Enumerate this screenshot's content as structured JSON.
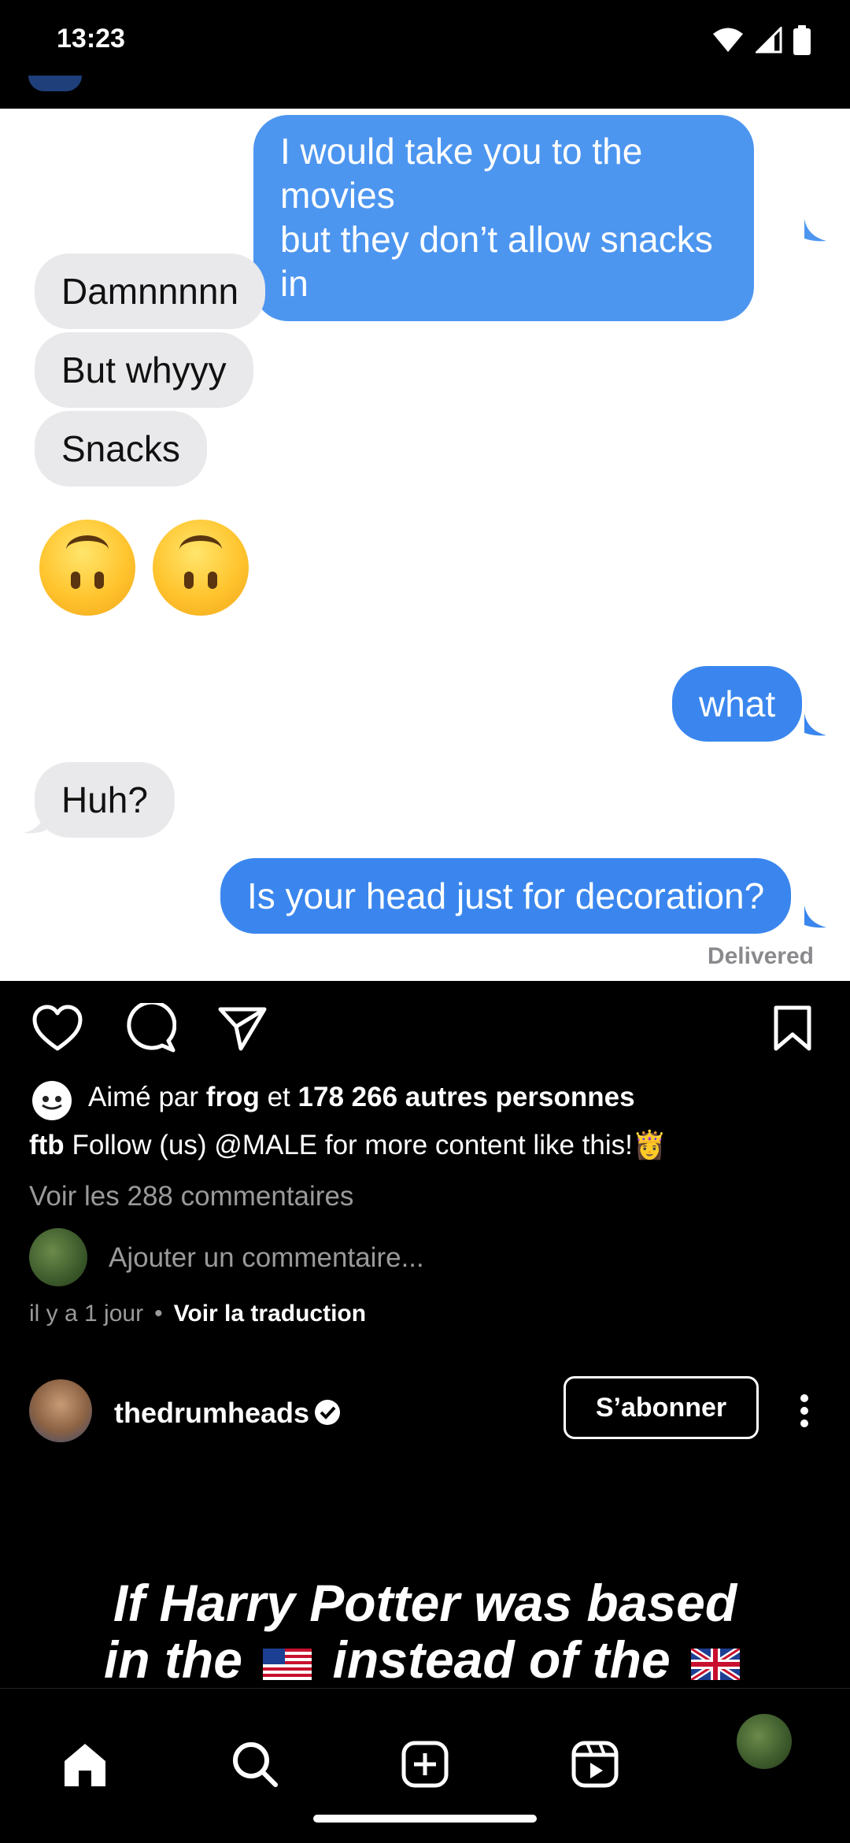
{
  "status_bar": {
    "time": "13:23"
  },
  "chat": {
    "messages": [
      {
        "side": "out",
        "lines": [
          "I would take you to the movies",
          "but they don’t allow snacks in"
        ]
      },
      {
        "side": "in",
        "text": "Damnnnnn"
      },
      {
        "side": "in",
        "text": "But whyyy"
      },
      {
        "side": "in",
        "text": "Snacks"
      },
      {
        "side": "in",
        "emoji": "upside-down-face-icon"
      },
      {
        "side": "out",
        "text": "what"
      },
      {
        "side": "in",
        "text": "Huh?"
      },
      {
        "side": "out",
        "text": "Is your head just for decoration?"
      }
    ],
    "delivered": "Delivered"
  },
  "post_actions": {
    "icons": [
      "heart-icon",
      "comment-icon",
      "share-icon",
      "bookmark-icon"
    ]
  },
  "likes": {
    "prefix": "Aimé par",
    "user": "frog",
    "joiner": "et",
    "count": "178 266 autres personnes"
  },
  "caption": {
    "username": "ftb",
    "text": "Follow (us) @MALE for more content like this!👸"
  },
  "view_comments": "Voir les 288 commentaires",
  "comment_placeholder": "Ajouter un commentaire...",
  "meta": {
    "time": "il y a 1 jour",
    "separator": "•",
    "translate": "Voir la traduction"
  },
  "next_post": {
    "username": "thedrumheads",
    "follow_label": "S’abonner",
    "text_line1": "If Harry Potter was based",
    "text_line2_a": "in the",
    "text_line2_b": "instead of the"
  },
  "bottom_nav": {
    "items": [
      "home-icon",
      "search-icon",
      "create-icon",
      "reels-icon",
      "profile-avatar"
    ]
  },
  "colors": {
    "outgoing_bubble": "#3a86ee",
    "incoming_bubble": "#e9e9eb",
    "background": "#000000"
  }
}
